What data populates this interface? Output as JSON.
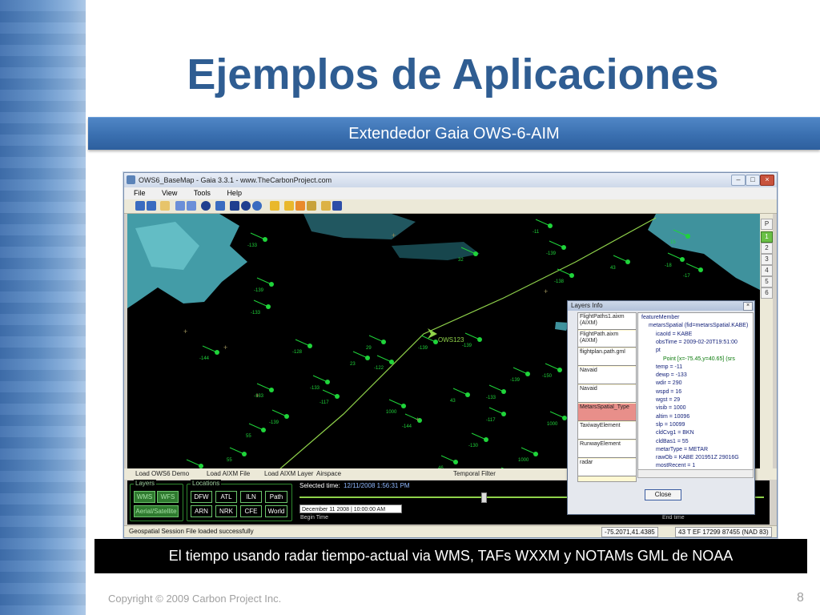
{
  "slide": {
    "title": "Ejemplos de Aplicaciones",
    "subtitle": "Extendedor Gaia OWS-6-AIM",
    "caption": "El tiempo usando radar tiempo-actual via WMS, TAFs WXXM y NOTAMs GML de NOAA",
    "footer": "Copyright © 2009 Carbon Project Inc.",
    "page_number": "8"
  },
  "window": {
    "title": "OWS6_BaseMap - Gaia 3.3.1 - www.TheCarbonProject.com",
    "menu": [
      "File",
      "View",
      "Tools",
      "Help"
    ],
    "controls": [
      "–",
      "□",
      "×"
    ]
  },
  "side_buttons": [
    "P",
    "1",
    "2",
    "3",
    "4",
    "5",
    "6"
  ],
  "map": {
    "aircraft_label": "OWS123",
    "station_labels": [
      "-133",
      "-139",
      "-133",
      "-144",
      "-133",
      "-139",
      "-133",
      "-128",
      "-117",
      "-122",
      "-144",
      "-139",
      "-130",
      "-133",
      "-117",
      "-139",
      "-144",
      "-139",
      "-150",
      "-144",
      "-133",
      "-138",
      "-139",
      "-11",
      "-18",
      "-17",
      "1000",
      "1000",
      "1000",
      "1000",
      "1000",
      "46",
      "43",
      "55",
      "55",
      "55",
      "55",
      "23",
      "29",
      "32",
      "43",
      "15"
    ]
  },
  "lower_toolbar": {
    "load_demo": "Load OWS6 Demo",
    "load_aixm_file": "Load AIXM File",
    "load_aixm_layer": "Load AIXM Layer",
    "airspace": "Airspace",
    "temporal_filter": "Temporal Filter"
  },
  "panel": {
    "layers_label": "Layers",
    "layers_buttons": [
      "WMS",
      "WFS",
      "Aerial/Satellite"
    ],
    "locations_label": "Locations",
    "locations_row1": [
      "DFW",
      "ATL",
      "ILN",
      "Path"
    ],
    "locations_row2": [
      "ARN",
      "NRK",
      "CFE",
      "World"
    ],
    "selected_time_label": "Selected time:",
    "selected_time_value": "12/11/2008 1:56:31 PM",
    "begin_date": "December 11 2008 | 10:00:00 AM",
    "begin_label": "Begin Time",
    "end_label": "End time"
  },
  "status": {
    "message": "Geospatial Session File loaded successfully",
    "coords": "-75.2071,41.4385",
    "grid": "43 T EF 17299 87455 (NAD 83)"
  },
  "layers_info": {
    "title": "Layers Info",
    "layers": [
      "FlightPaths1.aixm (AIXM)",
      "FlightPath.aixm (AIXM)",
      "flightplan.path.gml",
      "Navaid",
      "Navaid",
      "MetarsSpatial_Type",
      "TaxiwayElement",
      "RunwayElement",
      "radar"
    ],
    "selected_layer": "MetarsSpatial_Type",
    "tree": [
      {
        "text": "featureMember",
        "indent": 0
      },
      {
        "text": "metarsSpatial (fid=metarsSpatial.KABE)",
        "indent": 1
      },
      {
        "text": "icaoId = KABE",
        "indent": 2
      },
      {
        "text": "obsTime = 2009-02-20T19:51:00",
        "indent": 2
      },
      {
        "text": "pt",
        "indent": 2
      },
      {
        "text": "Point [x=-75.45,y=40.65] (srs",
        "indent": 3
      },
      {
        "text": "temp = -11",
        "indent": 2
      },
      {
        "text": "dewp = -133",
        "indent": 2
      },
      {
        "text": "wdir = 290",
        "indent": 2
      },
      {
        "text": "wspd = 16",
        "indent": 2
      },
      {
        "text": "wgst = 29",
        "indent": 2
      },
      {
        "text": "visib = 1000",
        "indent": 2
      },
      {
        "text": "altim = 10096",
        "indent": 2
      },
      {
        "text": "slp = 10099",
        "indent": 2
      },
      {
        "text": "cldCvg1 = BKN",
        "indent": 2
      },
      {
        "text": "cldBas1 = 55",
        "indent": 2
      },
      {
        "text": "metarType = METAR",
        "indent": 2
      },
      {
        "text": "rawOb = KABE 201951Z 29016G",
        "indent": 2
      },
      {
        "text": "mostRecent = 1",
        "indent": 2
      }
    ],
    "close_label": "Close"
  },
  "colors": {
    "title": "#2f5d92",
    "subbar": "#3a6fb0",
    "radar": "#4fb7c4",
    "station": "#1fd43a",
    "flight_path": "#8fd24a"
  }
}
